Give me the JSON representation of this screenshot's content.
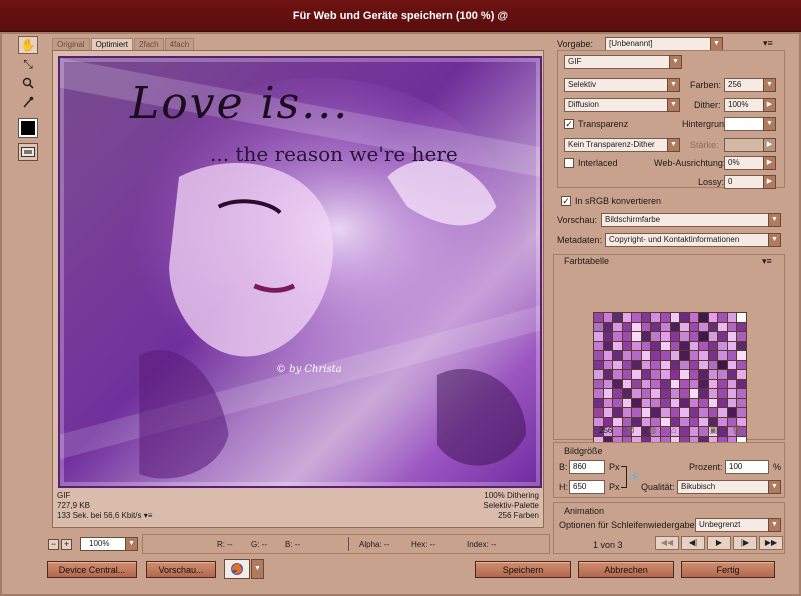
{
  "window": {
    "title": "Für Web und Geräte speichern (100 %) @"
  },
  "tools": [
    {
      "name": "hand-tool-icon",
      "glyph": "✋"
    },
    {
      "name": "slice-select-tool-icon",
      "glyph": "⤡"
    },
    {
      "name": "zoom-tool-icon",
      "glyph": "🔍"
    },
    {
      "name": "eyedropper-tool-icon",
      "glyph": "⁄"
    }
  ],
  "tabs": [
    "Original",
    "Optimiert",
    "2fach",
    "4fach"
  ],
  "image": {
    "title": "Love is...",
    "subtitle": "... the reason we're here",
    "credit": "© by Christa"
  },
  "info_left": [
    "GIF",
    "727,9 KB",
    "133 Sek. bei 56,6 Kbit/s"
  ],
  "info_right": [
    "100% Dithering",
    "Selektiv-Palette",
    "256 Farben"
  ],
  "zoom": {
    "minus": "−",
    "plus": "+",
    "value": "100%"
  },
  "color_readout": {
    "r": "R: --",
    "g": "G: --",
    "b": "B: --",
    "alpha": "Alpha: --",
    "hex": "Hex: --",
    "index": "Index: --"
  },
  "buttons": {
    "device_central": "Device Central...",
    "preview": "Vorschau...",
    "save": "Speichern",
    "cancel": "Abbrechen",
    "done": "Fertig"
  },
  "settings": {
    "preset_label": "Vorgabe:",
    "preset_value": "[Unbenannt]",
    "format": "GIF",
    "reduction": "Selektiv",
    "colors_label": "Farben:",
    "colors_value": "256",
    "dither_algo": "Diffusion",
    "dither_label": "Dither:",
    "dither_value": "100%",
    "transparency_label": "Transparenz",
    "transparency_checked": true,
    "matte_label": "Hintergrund:",
    "trans_dither": "Kein Transparenz-Dither",
    "amount_label": "Stärke:",
    "interlaced_label": "Interlaced",
    "interlaced_checked": false,
    "web_snap_label": "Web-Ausrichtung:",
    "web_snap_value": "0%",
    "lossy_label": "Lossy:",
    "lossy_value": "0",
    "srgb_label": "In sRGB konvertieren",
    "srgb_checked": true,
    "preview_label": "Vorschau:",
    "preview_value": "Bildschirmfarbe",
    "metadata_label": "Metadaten:",
    "metadata_value": "Copyright- und Kontaktinformationen"
  },
  "color_table": {
    "heading": "Farbtabelle",
    "count": "256",
    "swatches": [
      "#8e4aa0",
      "#c77bd6",
      "#5a2d6e",
      "#e3a6ee",
      "#b35ec8",
      "#7c3a94",
      "#d28fe2",
      "#a04ab6",
      "#f0c8f6",
      "#6a2c82",
      "#c26cd4",
      "#3a1a4a",
      "#e89af0",
      "#9c56b0",
      "#d6a0e4",
      "#ffffff",
      "#b070c4",
      "#5e2872",
      "#d896e6",
      "#8a3ea2",
      "#f4d2f8",
      "#a65abc",
      "#702e86",
      "#c87ed8",
      "#4a2058",
      "#e0b0ec",
      "#9848ae",
      "#cc88dc",
      "#62307a",
      "#eab8f2",
      "#b466c6",
      "#7e3496",
      "#dca2ea",
      "#6c2a80",
      "#c072d2",
      "#9a4cb0",
      "#f6daf9",
      "#542460",
      "#b87ccb",
      "#e49aee",
      "#84389c",
      "#ca84da",
      "#a852be",
      "#3e1848",
      "#d49ce2",
      "#7a3292",
      "#eec4f4",
      "#a660ba",
      "#c47ad4",
      "#582666",
      "#e8aef0",
      "#8c40a4",
      "#d28adf",
      "#b262c6",
      "#6e2c84",
      "#f2ccf6",
      "#9e50b4",
      "#4c1e5a",
      "#dea6ea",
      "#a858bc",
      "#7a3490",
      "#ca90dc",
      "#e6b4f0",
      "#5c2a6c",
      "#9a4eb0",
      "#d898e4",
      "#682a7c",
      "#c882d8",
      "#b468c8",
      "#f0c4f4",
      "#86389e",
      "#a04cb6",
      "#dcaae8",
      "#4a1c56",
      "#bc74ce",
      "#e4a4ee",
      "#76328c",
      "#ce8ede",
      "#a25abc",
      "#f8e0fa",
      "#7c3694",
      "#c67cd6",
      "#e0acec",
      "#9448ac",
      "#562462",
      "#d694e4",
      "#aa5ec0",
      "#ecbaf2",
      "#6a2c7e",
      "#c080d2",
      "#8e42a6",
      "#deb0ea",
      "#b06cc4",
      "#3c1646",
      "#e8b2f0",
      "#a054b6",
      "#d2a0e2",
      "#602a74",
      "#c478d4",
      "#9c52b2",
      "#eec0f4",
      "#782e8e",
      "#b66ec8",
      "#dc9eea",
      "#882e9e",
      "#f2d0f6",
      "#a44eb8",
      "#5a2268",
      "#d08cde",
      "#bc7ece",
      "#6e2c82",
      "#e2aeec",
      "#a65cba",
      "#cc88da",
      "#522060",
      "#eabaf2",
      "#90449e",
      "#d496e2",
      "#b866ca",
      "#742e88",
      "#f4d6f8",
      "#a852bc",
      "#c27ad2",
      "#4e1e5a",
      "#e6aaee",
      "#9646ac",
      "#d69ce4",
      "#6c287e",
      "#be74ce",
      "#ecc2f4",
      "#8a3ea0",
      "#582464",
      "#d090de",
      "#b064c4",
      "#e4b0ee",
      "#7e3292",
      "#c886d8",
      "#a04eb4",
      "#f6dcf8",
      "#622a76",
      "#d898e6",
      "#9a4aae",
      "#e0a8ea",
      "#b26ac6",
      "#702c86",
      "#cc82da",
      "#a658bc",
      "#eec6f4",
      "#4c1c58",
      "#d494e2",
      "#be78d0",
      "#8c3ea2",
      "#e8b6f0",
      "#5e2670",
      "#c67ed6",
      "#a252b8",
      "#f2d2f6",
      "#7a308e",
      "#dba4e8",
      "#b46ec8",
      "#94469e",
      "#e2acec",
      "#662a78",
      "#c984d8",
      "#ad60c2",
      "#f0cef6",
      "#542262",
      "#d69ae4",
      "#a04cb4",
      "#eab8f2",
      "#7c3490",
      "#c27cd2",
      "#9e50b2",
      "#deaaea",
      "#4a1a56",
      "#b870ca",
      "#d08ee0",
      "#882c9c",
      "#ecbef4",
      "#a65ebc",
      "#602874",
      "#d896e4",
      "#b468c8",
      "#f4d8f8",
      "#7a3290",
      "#c680d6",
      "#9a4aae",
      "#e4b2ee",
      "#5a2468",
      "#cc8adc",
      "#aa5cbe",
      "#e89ef0",
      "#70308a",
      "#d8a2e6",
      "#be76d0",
      "#8e40a4",
      "#eec2f4",
      "#562466",
      "#c47cd4",
      "#a452b8",
      "#e0aaec",
      "#7e3694",
      "#d292e0",
      "#b26cc6",
      "#f6dafa",
      "#682a7c",
      "#ca86da",
      "#9c4eb2",
      "#e6b0ee",
      "#4e1e5c",
      "#c078d0",
      "#a85abc",
      "#dca6e8",
      "#762e8c",
      "#d496e2",
      "#b066c4",
      "#f0caf6",
      "#8c40a2",
      "#cc88dc",
      "#5c2a6e",
      "#e2aaec",
      "#a050b6",
      "#c67ed6",
      "#ffffff",
      "#6a2a80",
      "#d89ae6",
      "#b26ac6",
      "#ecbcf2",
      "#8a3ca0",
      "#c278d2",
      "#52205e",
      "#e4aeee",
      "#a254b8",
      "#d08ede",
      "#7a3490",
      "#f2d0f6",
      "#be74ce",
      "#9848ae",
      "#dca2ea",
      "#ffffff"
    ]
  },
  "image_size": {
    "heading": "Bildgröße",
    "w_label": "B:",
    "w_value": "860",
    "w_unit": "Px",
    "h_label": "H:",
    "h_value": "650",
    "h_unit": "Px",
    "percent_label": "Prozent:",
    "percent_value": "100",
    "percent_unit": "%",
    "quality_label": "Qualität:",
    "quality_value": "Bikubisch"
  },
  "animation": {
    "heading": "Animation",
    "loop_label": "Optionen für Schleifenwiedergabe:",
    "loop_value": "Unbegrenzt",
    "frame_counter": "1 von 3",
    "controls": [
      "◀◀",
      "◀|",
      "▶",
      "|▶",
      "▶▶"
    ]
  }
}
